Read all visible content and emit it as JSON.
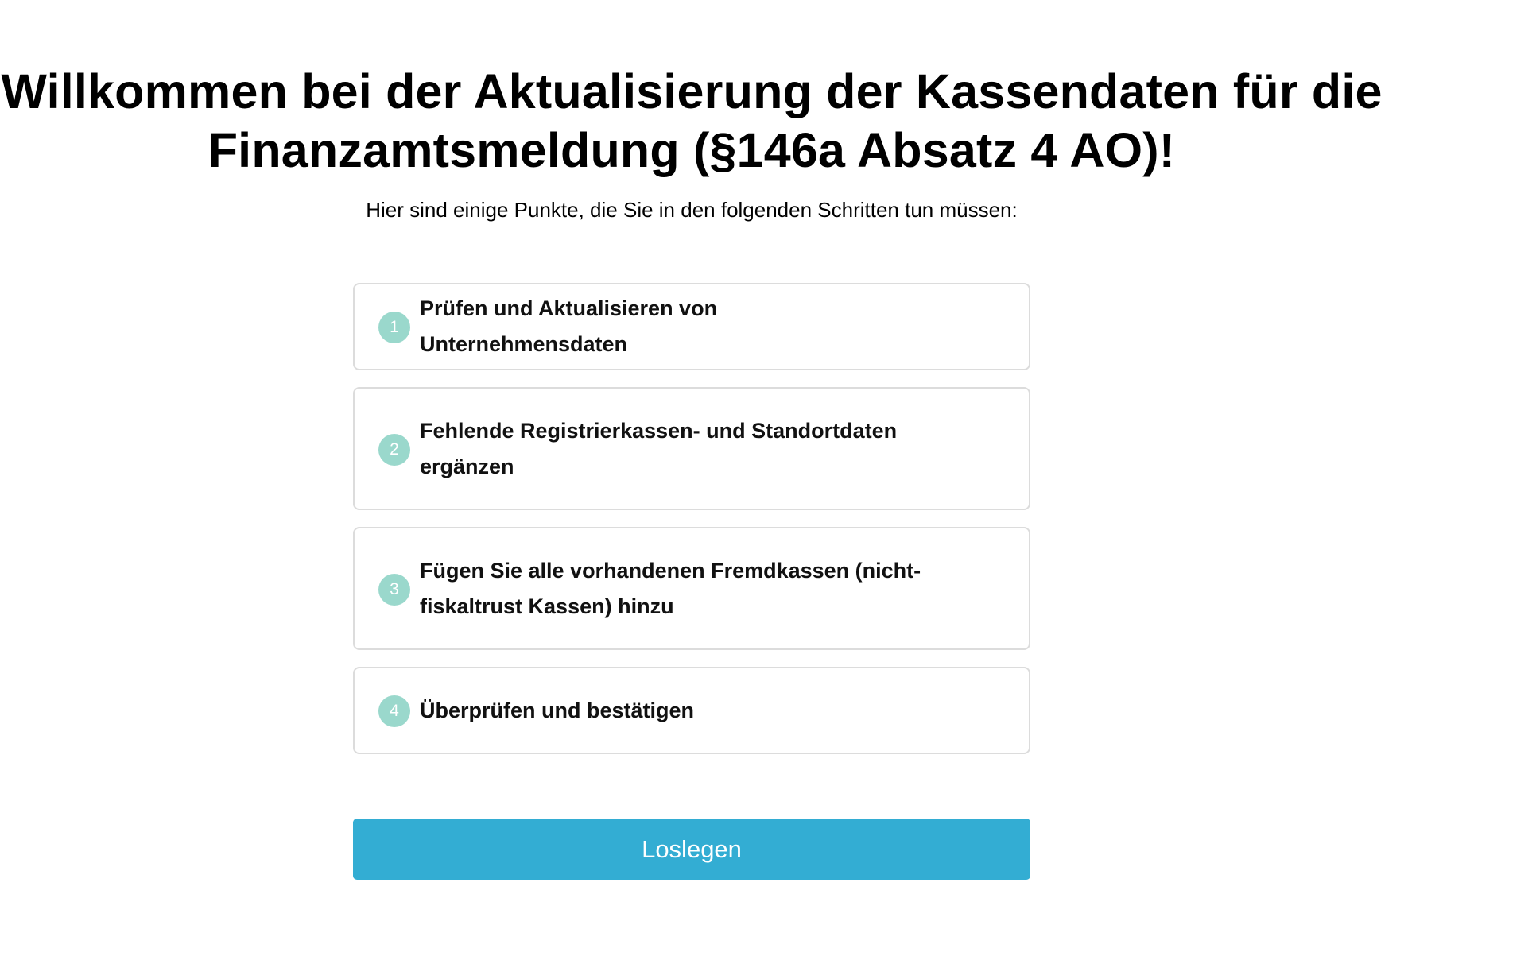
{
  "welcome": {
    "title_line1": "Willkommen bei der Aktualisierung der Kassendaten für die",
    "title_line2": "Finanzamtsmeldung (§146a Absatz 4 AO)!",
    "intro": "Hier sind einige Punkte, die Sie in den folgenden Schritten tun müssen:"
  },
  "steps": [
    {
      "number": "1",
      "label": "Prüfen und Aktualisieren von Unternehmensdaten"
    },
    {
      "number": "2",
      "label": "Fehlende Registrierkassen- und Standortdaten ergänzen"
    },
    {
      "number": "3",
      "label": "Fügen Sie alle vorhandenen Fremdkassen (nicht-fiskaltrust Kassen) hinzu"
    },
    {
      "number": "4",
      "label": "Überprüfen und bestätigen"
    }
  ],
  "actions": {
    "start_label": "Loslegen"
  },
  "colors": {
    "accent": "#33add3",
    "badge": "#9ad8cc",
    "card_border": "#dcdcdc"
  }
}
